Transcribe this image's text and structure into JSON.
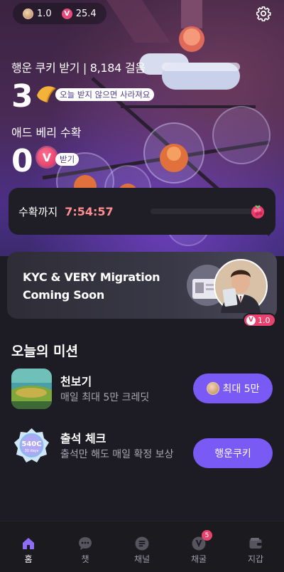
{
  "header": {
    "coin_value": "1.0",
    "very_value": "25.4"
  },
  "fortune": {
    "label": "행운 쿠키 받기 | 8,184 걸음",
    "count": "3",
    "note": "오늘 받지 않으면 사라져요"
  },
  "berry": {
    "label": "애드 베리 수확",
    "count": "0",
    "note": "받기"
  },
  "harvest": {
    "label": "수확까지",
    "timer": "7:54:57",
    "progress": 0
  },
  "banner": {
    "line1": "KYC & VERY Migration",
    "line2": "Coming Soon",
    "reward": "1.0"
  },
  "missions": {
    "title": "오늘의 미션",
    "items": [
      {
        "title": "천보기",
        "subtitle": "매일 최대 5만 크레딧",
        "button": "최대 5만"
      },
      {
        "title": "출석 체크",
        "subtitle": "출석만 해도 매일 확정 보상",
        "button": "행운쿠키",
        "badge": "540C",
        "badge_sub": "30 days"
      }
    ]
  },
  "tabs": [
    {
      "label": "홈",
      "icon": "home-icon",
      "active": true
    },
    {
      "label": "챗",
      "icon": "chat-icon"
    },
    {
      "label": "채널",
      "icon": "channel-icon"
    },
    {
      "label": "채굴",
      "icon": "mining-icon",
      "badge": "5"
    },
    {
      "label": "지갑",
      "icon": "wallet-icon"
    }
  ],
  "colors": {
    "accent": "#7a5af5",
    "timer": "#ff8d8d",
    "very": "#e8436f"
  }
}
